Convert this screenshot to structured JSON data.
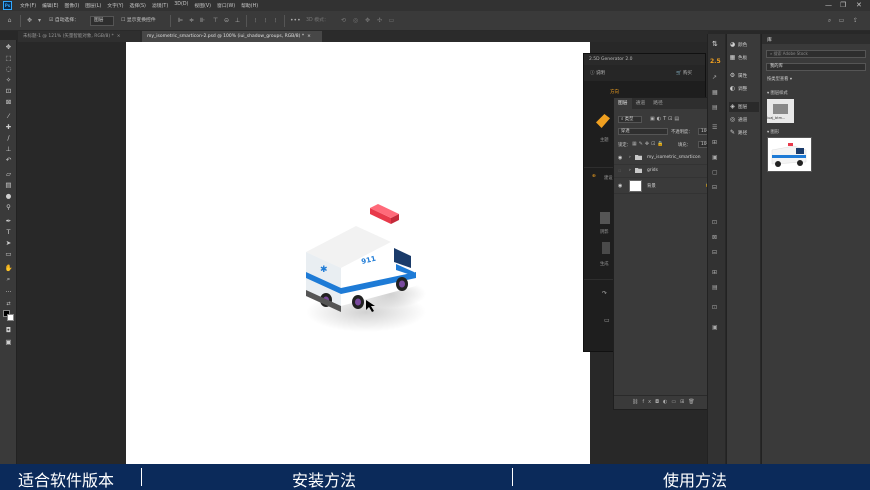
{
  "app": {
    "logo": "Ps",
    "menu": [
      "文件(F)",
      "编辑(E)",
      "图像(I)",
      "图层(L)",
      "文字(Y)",
      "选择(S)",
      "滤镜(T)",
      "3D(D)",
      "视图(V)",
      "窗口(W)",
      "帮助(H)"
    ],
    "window_controls": [
      "—",
      "❐",
      "✕"
    ]
  },
  "options_bar": {
    "auto_select_label": "自动选择：",
    "auto_select_value": "图层",
    "show_transform_label": "显示变换控件",
    "mode_3d_label": "3D 模式："
  },
  "tabs": [
    {
      "label": "未标题-1 @ 121% (矢量智能对象, RGB/8) *",
      "active": false
    },
    {
      "label": "my_isometric_smarticon-2.psd @ 100% (iui_shadow_groups, RGB/8) *",
      "active": true
    }
  ],
  "toolbar": {
    "tools": [
      "move-tool",
      "marquee-tool",
      "lasso-tool",
      "magic-wand-tool",
      "crop-tool",
      "frame-tool",
      "eyedropper-tool",
      "healing-tool",
      "brush-tool",
      "stamp-tool",
      "history-brush-tool",
      "eraser-tool",
      "gradient-tool",
      "blur-tool",
      "dodge-tool",
      "pen-tool",
      "type-tool",
      "path-select-tool",
      "shape-tool",
      "hand-tool",
      "zoom-tool",
      "more-tools",
      "swap-colors",
      "color-swatches",
      "quick-mask",
      "screen-mode"
    ]
  },
  "plugin_panel": {
    "title": "2.5D Generator 2.0",
    "nav_left": "说明",
    "nav_right": "购买",
    "section_label": "方向",
    "label_main": "主题",
    "label_b": "建设",
    "label_c": "阴影",
    "label_d": "生成"
  },
  "layers_panel": {
    "tabs": [
      "图层",
      "通道",
      "路径"
    ],
    "filter_label": "类型",
    "blend_mode": "穿透",
    "opacity_label": "不透明度：",
    "opacity_value": "100%",
    "lock_label": "锁定：",
    "fill_label": "填充：",
    "fill_value": "100%",
    "layers": [
      {
        "name": "my_isometric_smarticon",
        "type": "group",
        "visible": true
      },
      {
        "name": "grids",
        "type": "group",
        "visible": false
      },
      {
        "name": "背景",
        "type": "background",
        "visible": true
      }
    ]
  },
  "right_strip": {
    "badge_25": "2.5",
    "group1": [
      {
        "icon": "color-icon",
        "label": "颜色"
      },
      {
        "icon": "swatches-icon",
        "label": "色板"
      }
    ],
    "group2": [
      {
        "icon": "properties-icon",
        "label": "属性"
      },
      {
        "icon": "adjustments-icon",
        "label": "调整"
      }
    ],
    "group3": [
      {
        "icon": "layers-icon",
        "label": "图层"
      },
      {
        "icon": "channels-icon",
        "label": "通道"
      },
      {
        "icon": "paths-icon",
        "label": "路径"
      }
    ]
  },
  "libraries": {
    "title": "库",
    "search_placeholder": "搜索 Adobe Stock",
    "library_name": "我的库",
    "view_label": "按类型查看",
    "section_styles": "图层样式",
    "style_item": "iuaj_btm...",
    "section_graphics": "图形"
  },
  "banner": {
    "left": "适合软件版本",
    "center": "安装方法",
    "right": "使用方法"
  },
  "colors": {
    "banner": "#0b2a5a",
    "accent_orange": "#f0a020",
    "ps_blue": "#31a8ff"
  }
}
